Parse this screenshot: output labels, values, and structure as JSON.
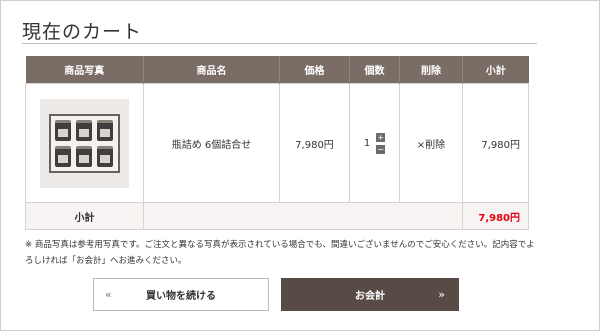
{
  "page": {
    "title": "現在のカート"
  },
  "table": {
    "headers": [
      "商品写真",
      "商品名",
      "価格",
      "個数",
      "削除",
      "小計"
    ],
    "items": [
      {
        "name": "瓶詰め 6個詰合せ",
        "price": "7,980円",
        "quantity": "1",
        "delete_label": "×削除",
        "subtotal": "7,980円"
      }
    ],
    "qty_plus": "+",
    "qty_minus": "−",
    "subtotal_label": "小計",
    "subtotal_value": "7,980円"
  },
  "note": "※ 商品写真は参考用写真です。ご注文と異なる写真が表示されている場合でも、間違いございませんのでご安心ください。記内容でよろしければ「お会計」へお進みください。",
  "buttons": {
    "continue": {
      "label": "買い物を続ける",
      "arrow": "«"
    },
    "checkout": {
      "label": "お会計",
      "arrow": "»"
    }
  },
  "colors": {
    "header_bg": "#7a6d66",
    "checkout_bg": "#584a44",
    "total_red": "#e60012"
  }
}
